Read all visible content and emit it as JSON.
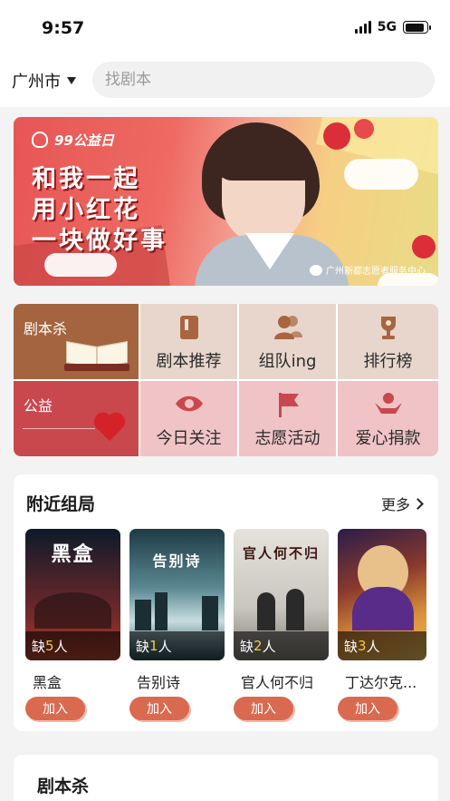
{
  "status_bar": {
    "time": "9:57",
    "network": "5G",
    "battery_level": 0.9
  },
  "header": {
    "city": "广州市",
    "search_placeholder": "找剧本"
  },
  "banner": {
    "tag": "99公益日",
    "lines": [
      "和我一起",
      "用小红花",
      "一块做好事"
    ],
    "credit": "广州新都志愿者服务中心"
  },
  "categories": {
    "juben": {
      "label": "剧本杀",
      "color": "#a3643f"
    },
    "gongyi": {
      "label": "公益",
      "color": "#c9484e"
    },
    "tiles": [
      {
        "label": "剧本推荐",
        "icon": "script-book-icon"
      },
      {
        "label": "组队ing",
        "icon": "team-icon"
      },
      {
        "label": "排行榜",
        "icon": "trophy-icon"
      },
      {
        "label": "今日关注",
        "icon": "eye-icon"
      },
      {
        "label": "志愿活动",
        "icon": "flag-icon"
      },
      {
        "label": "爱心捐款",
        "icon": "donate-hands-icon"
      }
    ]
  },
  "nearby": {
    "title": "附近组局",
    "more": "更多",
    "groups": [
      {
        "name": "黑盒",
        "poster_text": "黑盒",
        "missing_prefix": "缺",
        "missing_count": "5",
        "missing_suffix": "人",
        "join": "加入"
      },
      {
        "name": "告别诗",
        "poster_text": "告别诗",
        "missing_prefix": "缺",
        "missing_count": "1",
        "missing_suffix": "人",
        "join": "加入"
      },
      {
        "name": "官人何不归",
        "poster_text": "官人何不归",
        "missing_prefix": "缺",
        "missing_count": "2",
        "missing_suffix": "人",
        "join": "加入"
      },
      {
        "name": "丁达尔克...",
        "poster_text": "",
        "missing_prefix": "缺",
        "missing_count": "3",
        "missing_suffix": "人",
        "join": "加入"
      }
    ]
  },
  "juben_section": {
    "title": "剧本杀"
  }
}
